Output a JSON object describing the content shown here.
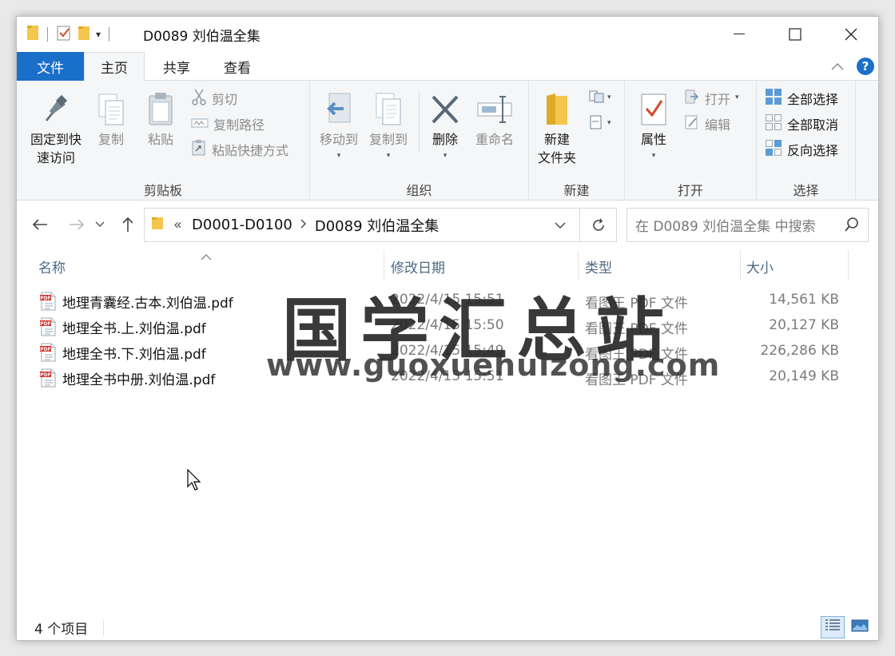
{
  "window": {
    "title": "D0089 刘伯温全集",
    "controls": {
      "minimize": "—",
      "maximize": "☐",
      "close": "✕"
    }
  },
  "ribbon_tabs": {
    "file": "文件",
    "home": "主页",
    "share": "共享",
    "view": "查看"
  },
  "ribbon": {
    "clipboard": {
      "label": "剪贴板",
      "pin_quick": "固定到快\n速访问",
      "pin_quick_line1": "固定到快",
      "pin_quick_line2": "速访问",
      "copy": "复制",
      "paste": "粘贴",
      "cut": "剪切",
      "copy_path": "复制路径",
      "paste_shortcut": "粘贴快捷方式"
    },
    "organize": {
      "label": "组织",
      "move_to": "移动到",
      "copy_to": "复制到",
      "delete": "删除",
      "rename": "重命名"
    },
    "new": {
      "label": "新建",
      "new_folder_line1": "新建",
      "new_folder_line2": "文件夹"
    },
    "open": {
      "label": "打开",
      "properties": "属性",
      "open": "打开",
      "edit": "编辑"
    },
    "select": {
      "label": "选择",
      "select_all": "全部选择",
      "select_none": "全部取消",
      "invert": "反向选择"
    }
  },
  "navigation": {
    "breadcrumb_overflow": "«",
    "crumbs": [
      "D0001-D0100",
      "D0089 刘伯温全集"
    ],
    "search_placeholder": "在 D0089 刘伯温全集 中搜索"
  },
  "columns": {
    "name": "名称",
    "date": "修改日期",
    "type": "类型",
    "size": "大小"
  },
  "files": [
    {
      "name": "地理青囊经.古本.刘伯温.pdf",
      "date": "2022/4/15 15:51",
      "type": "看图王 PDF 文件",
      "size": "14,561 KB"
    },
    {
      "name": "地理全书.上.刘伯温.pdf",
      "date": "2022/4/15 15:50",
      "type": "看图王 PDF 文件",
      "size": "20,127 KB"
    },
    {
      "name": "地理全书.下.刘伯温.pdf",
      "date": "2022/4/15 15:49",
      "type": "看图王 PDF 文件",
      "size": "226,286 KB"
    },
    {
      "name": "地理全书中册.刘伯温.pdf",
      "date": "2022/4/15 15:51",
      "type": "看图王 PDF 文件",
      "size": "20,149 KB"
    }
  ],
  "watermark": {
    "cn": "国学汇总站",
    "url": "www.guoxuehuizong.com"
  },
  "status": {
    "item_count": "4 个项目"
  },
  "colors": {
    "file_tab": "#1a6fc9",
    "header_text": "#4d6a84",
    "ribbon_bg": "#f5f6f7"
  }
}
